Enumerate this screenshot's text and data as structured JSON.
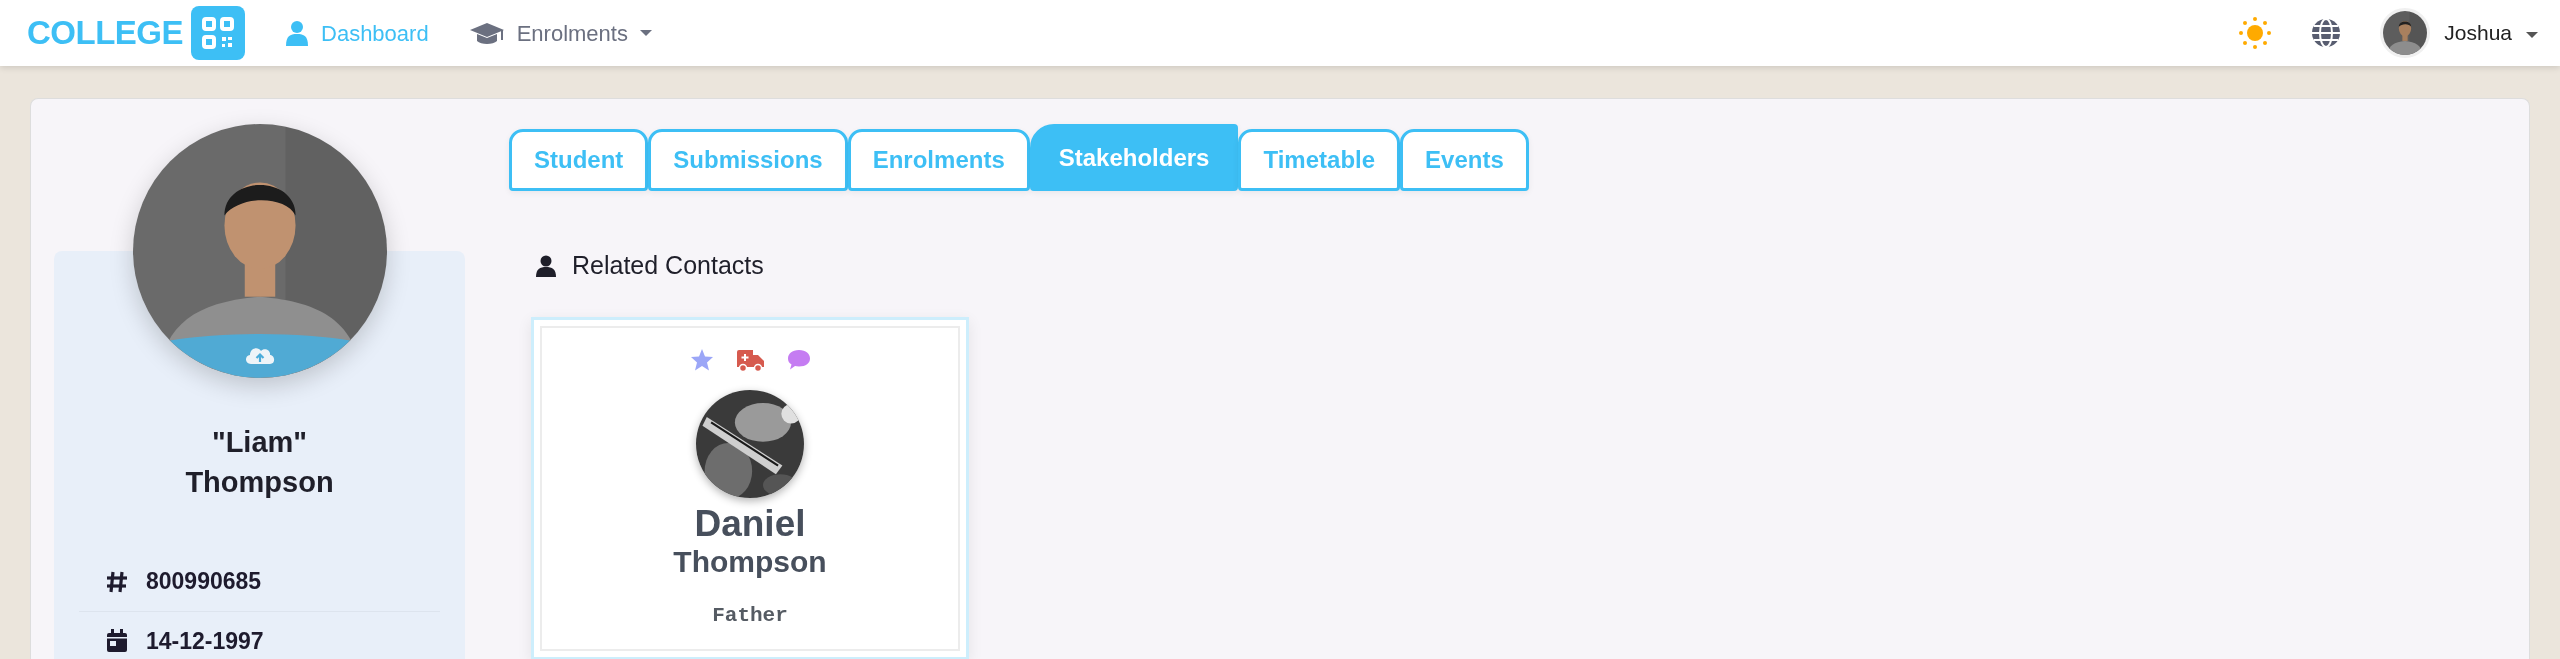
{
  "navbar": {
    "brand": "COLLEGE",
    "links": [
      {
        "label": "Dashboard",
        "selected": true,
        "dropdown": false
      },
      {
        "label": "Enrolments",
        "selected": false,
        "dropdown": true
      }
    ],
    "user": {
      "name": "Joshua",
      "dropdown": true
    }
  },
  "student": {
    "nickname": "\"Liam\"",
    "surname": "Thompson",
    "details": [
      {
        "kind": "id",
        "value": "800990685"
      },
      {
        "kind": "date",
        "value": "14-12-1997"
      }
    ]
  },
  "tabs": [
    {
      "label": "Student",
      "selected": false
    },
    {
      "label": "Submissions",
      "selected": false
    },
    {
      "label": "Enrolments",
      "selected": false
    },
    {
      "label": "Stakeholders",
      "selected": true
    },
    {
      "label": "Timetable",
      "selected": false
    },
    {
      "label": "Events",
      "selected": false
    }
  ],
  "section": {
    "title": "Related Contacts"
  },
  "contacts": [
    {
      "first_name": "Daniel",
      "last_name": "Thompson",
      "relationship": "Father",
      "flags": [
        {
          "kind": "primary"
        },
        {
          "kind": "emergency"
        },
        {
          "kind": "message"
        }
      ]
    }
  ]
}
